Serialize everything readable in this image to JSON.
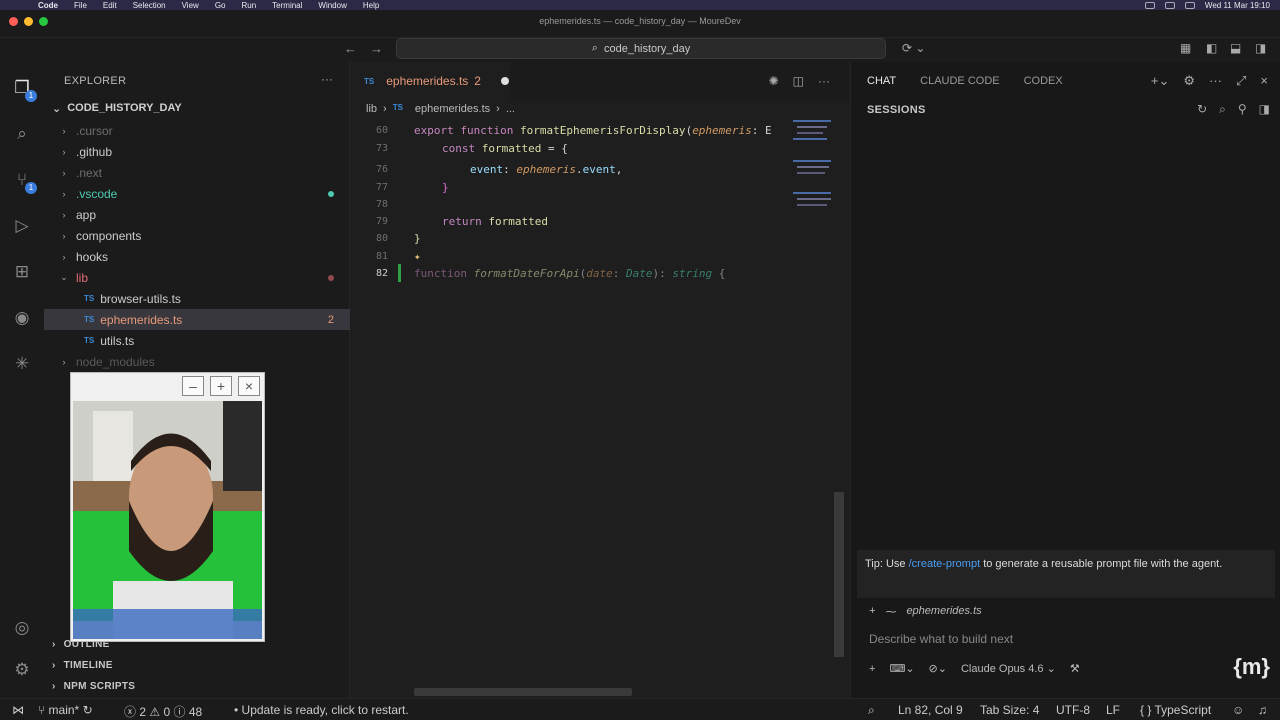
{
  "menubar": {
    "app": "Code",
    "items": [
      "File",
      "Edit",
      "Selection",
      "View",
      "Go",
      "Run",
      "Terminal",
      "Window",
      "Help"
    ],
    "clock": "Wed 11 Mar 19:10"
  },
  "window": {
    "title": "ephemerides.ts — code_history_day — MoureDev"
  },
  "command_center": {
    "search": "code_history_day"
  },
  "sidebar": {
    "header": "EXPLORER",
    "project": "CODE_HISTORY_DAY",
    "tree": [
      {
        "label": ".cursor",
        "dim": true
      },
      {
        "label": ".github"
      },
      {
        "label": ".next",
        "dim": true
      },
      {
        "label": ".vscode",
        "color": "#4ec9b0"
      },
      {
        "label": "app"
      },
      {
        "label": "components"
      },
      {
        "label": "hooks"
      },
      {
        "label": "lib",
        "color": "#e06c75"
      },
      {
        "label": "browser-utils.ts"
      },
      {
        "label": "ephemerides.ts",
        "badge": "2"
      },
      {
        "label": "utils.ts"
      },
      {
        "label": "node_modules",
        "dim": true
      }
    ],
    "footer": [
      "OUTLINE",
      "TIMELINE",
      "NPM SCRIPTS"
    ]
  },
  "editor": {
    "tab": {
      "label": "ephemerides.ts",
      "problems": "2"
    },
    "breadcrumb": [
      "lib",
      "ephemerides.ts",
      "..."
    ],
    "line_numbers": [
      "60",
      "73",
      "76",
      "77",
      "78",
      "79",
      "80",
      "81",
      "82"
    ],
    "lines": {
      "l60": [
        "export",
        "function",
        "formatEphemerisForDisplay",
        "(",
        "ephemeris",
        ": E"
      ],
      "l73": [
        "const",
        "formatted",
        "= {"
      ],
      "l76": [
        "event",
        ":",
        "ephemeris",
        ".",
        "event",
        ","
      ],
      "l77": "}",
      "l79": [
        "return",
        "formatted"
      ],
      "l80": "}",
      "l82": [
        "function",
        "formatDateForApi",
        "(",
        "date",
        ":",
        "Date",
        "):",
        "string",
        "{"
      ]
    }
  },
  "chat": {
    "tabs": [
      "CHAT",
      "CLAUDE CODE",
      "CODEX"
    ],
    "sessions": "SESSIONS",
    "tip_prefix": "Tip: Use",
    "tip_link": "/create-prompt",
    "tip_suffix": "to generate a reusable prompt file with the agent.",
    "context_file": "ephemerides.ts",
    "placeholder": "Describe what to build next",
    "model": "Claude Opus 4.6",
    "logo": "{m}"
  },
  "statusbar": {
    "branch": "main*",
    "errors": "2",
    "warnings": "0",
    "info": "48",
    "update": "Update is ready, click to restart.",
    "position": "Ln 82, Col 9",
    "tab_size": "Tab Size: 4",
    "encoding": "UTF-8",
    "eol": "LF",
    "language": "TypeScript"
  },
  "colors": {
    "accent": "#3b7ddd",
    "tab_text": "#e89a7a"
  }
}
